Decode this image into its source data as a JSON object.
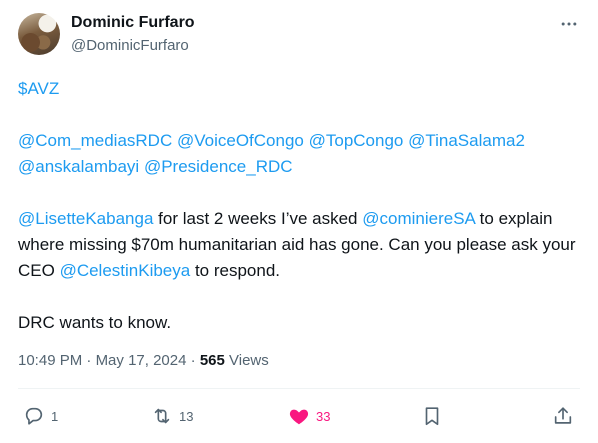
{
  "tweet": {
    "author_name": "Dominic Furfaro",
    "author_handle": "@DominicFurfaro",
    "cashtag": "$AVZ",
    "mentions_line1": [
      "@Com_mediasRDC",
      "@VoiceOfCongo",
      "@TopCongo",
      "@TinaSalama2"
    ],
    "mentions_line2": [
      "@anskalambayi",
      "@Presidence_RDC"
    ],
    "para": {
      "m1": "@LisetteKabanga",
      "t1": " for last 2 weeks I’ve asked ",
      "m2": "@cominiereSA",
      "t2": " to explain where missing $70m humanitarian aid has gone. Can you please ask your CEO ",
      "m3": "@CelestinKibeya",
      "t3": " to respond."
    },
    "closing": "DRC wants to know.",
    "time": "10:49 PM",
    "sep": " · ",
    "date": "May 17, 2024",
    "views_count": "565",
    "views_label": " Views"
  },
  "actions": {
    "reply_count": "1",
    "retweet_count": "13",
    "like_count": "33"
  },
  "icons": {
    "more": "more-horizontal-icon",
    "reply": "reply-icon",
    "retweet": "retweet-icon",
    "like": "heart-filled-icon",
    "bookmark": "bookmark-icon",
    "share": "share-icon"
  },
  "colors": {
    "link": "#1d9bf0",
    "like": "#f91880",
    "secondary": "#536471",
    "text": "#0f1419"
  }
}
